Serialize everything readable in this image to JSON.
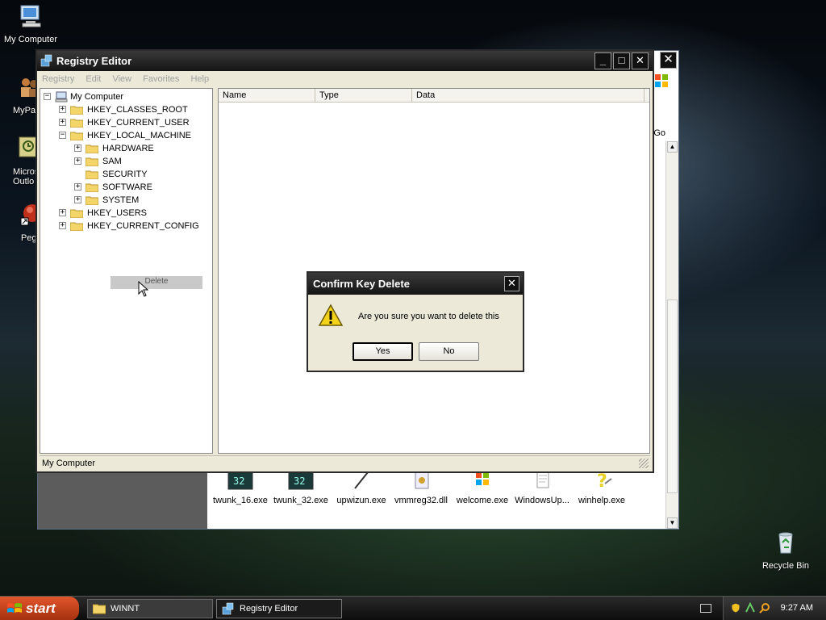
{
  "desktop": {
    "icons": [
      {
        "label": "My Computer"
      },
      {
        "label": "MyPa"
      },
      {
        "label": "Micros Outlo"
      },
      {
        "label": "Peg"
      },
      {
        "label": "Recycle Bin"
      }
    ]
  },
  "background_window": {
    "go_label": "Go",
    "files": [
      {
        "label": "twunk_16.exe"
      },
      {
        "label": "twunk_32.exe"
      },
      {
        "label": "upwizun.exe"
      },
      {
        "label": "vmmreg32.dll"
      },
      {
        "label": "welcome.exe"
      },
      {
        "label": "WindowsUp..."
      },
      {
        "label": "winhelp.exe"
      }
    ],
    "close_glyph": "✕"
  },
  "registry_editor": {
    "title": "Registry Editor",
    "menu": [
      "Registry",
      "Edit",
      "View",
      "Favorites",
      "Help"
    ],
    "tree": [
      {
        "label": "My Computer",
        "expander": "−"
      },
      {
        "label": "HKEY_CLASSES_ROOT",
        "expander": "+"
      },
      {
        "label": "HKEY_CURRENT_USER",
        "expander": "+"
      },
      {
        "label": "HKEY_LOCAL_MACHINE",
        "expander": "−"
      },
      {
        "label": "HARDWARE",
        "expander": "+"
      },
      {
        "label": "SAM",
        "expander": "+"
      },
      {
        "label": "SECURITY",
        "expander": ""
      },
      {
        "label": "SOFTWARE",
        "expander": "+"
      },
      {
        "label": "SYSTEM",
        "expander": "+"
      },
      {
        "label": "HKEY_USERS",
        "expander": "+"
      },
      {
        "label": "HKEY_CURRENT_CONFIG",
        "expander": "+"
      }
    ],
    "context_item": "Delete",
    "columns": [
      "Name",
      "Type",
      "Data"
    ],
    "status": "My Computer",
    "buttons": {
      "minimize": "_",
      "maximize": "□",
      "close": "✕"
    }
  },
  "dialog": {
    "title": "Confirm Key Delete",
    "message": "Are you sure you want to delete this",
    "yes_label": "Yes",
    "no_label": "No",
    "close_glyph": "✕"
  },
  "taskbar": {
    "start_label": "start",
    "tasks": [
      {
        "label": "WINNT"
      },
      {
        "label": "Registry Editor"
      }
    ],
    "clock": "9:27 AM"
  }
}
